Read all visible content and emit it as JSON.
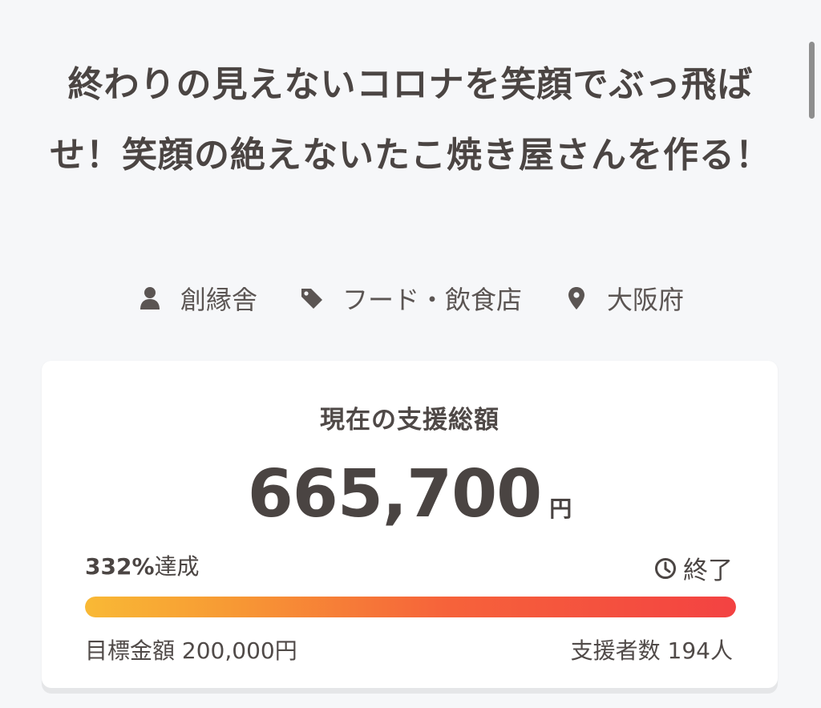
{
  "project": {
    "title": "終わりの見えないコロナを笑顔でぶっ飛ばせ！笑顔の絶えないたこ焼き屋さんを作る！",
    "owner": "創縁舎",
    "category": "フード・飲食店",
    "location": "大阪府"
  },
  "icons": {
    "owner": "user-icon",
    "category": "tag-icon",
    "location": "map-pin-icon",
    "status": "clock-icon"
  },
  "funding": {
    "label": "現在の支援総額",
    "amount": "665,700",
    "currency": "円",
    "achieved_percent": "332%",
    "achieved_suffix": "達成",
    "status": "終了",
    "progress_fraction": 1.0,
    "goal_label": "目標金額",
    "goal_amount": "200,000円",
    "backers_label": "支援者数",
    "backers_count": "194人"
  },
  "colors": {
    "progress_start": "#f9b935",
    "progress_end": "#f34242",
    "text": "#4a4544",
    "background": "#f6f7f9"
  }
}
